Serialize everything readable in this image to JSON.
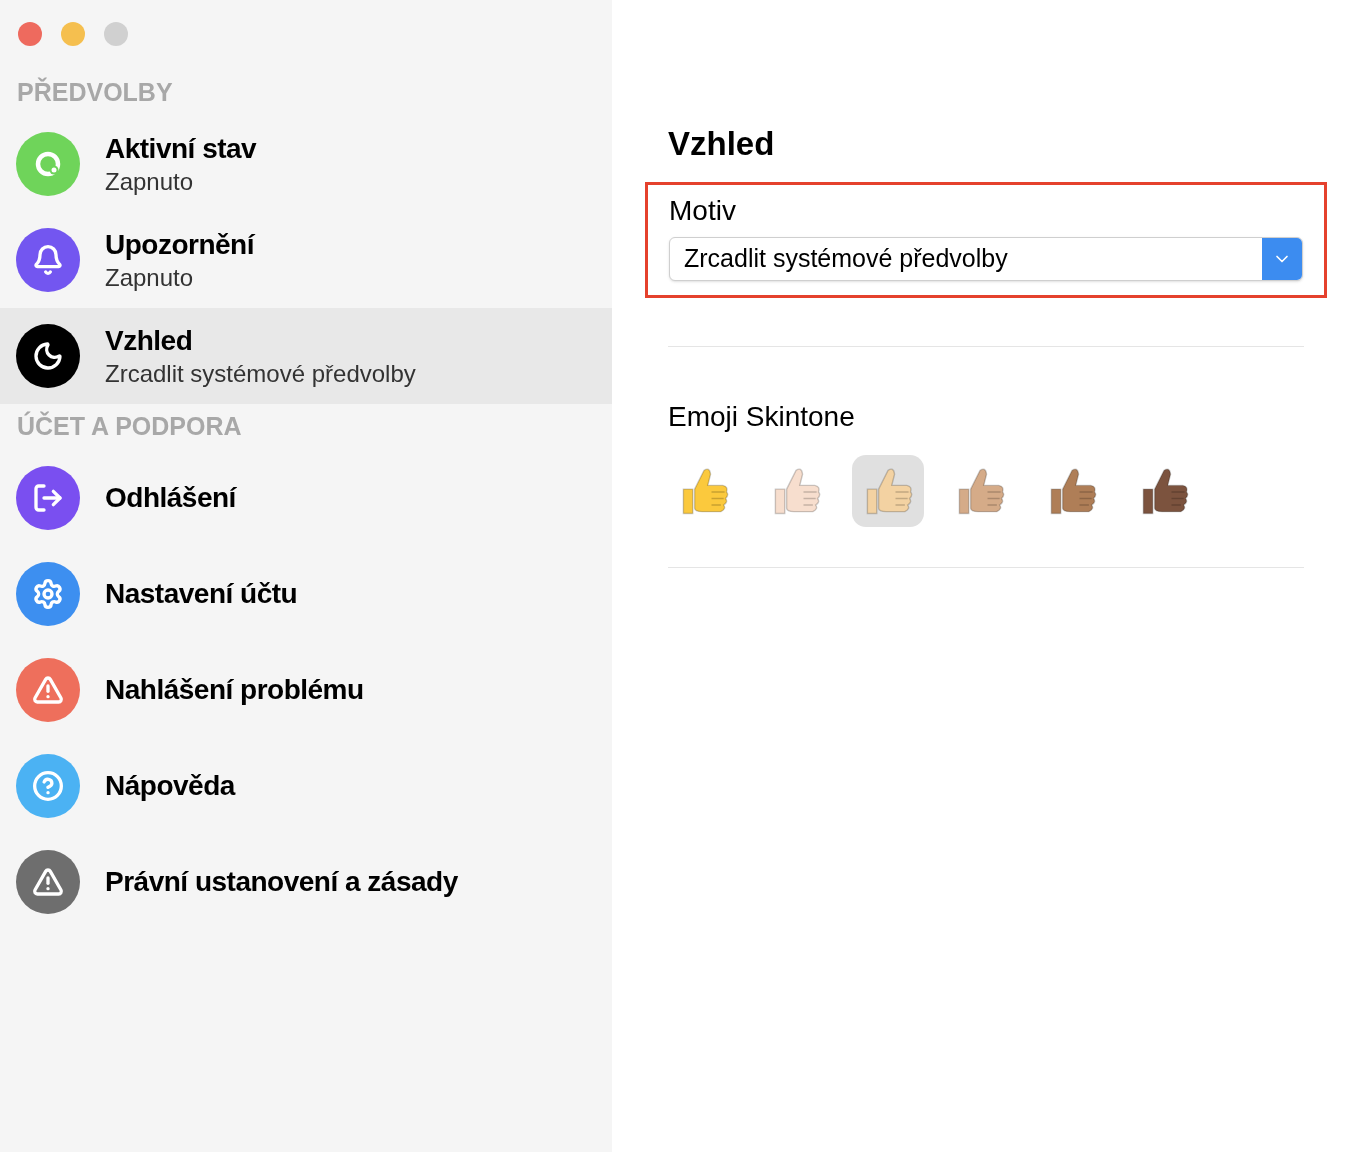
{
  "sidebar": {
    "sections": [
      {
        "title": "PŘEDVOLBY",
        "items": [
          {
            "title": "Aktivní stav",
            "subtitle": "Zapnuto",
            "color": "#6fd45a",
            "selected": false
          },
          {
            "title": "Upozornění",
            "subtitle": "Zapnuto",
            "color": "#7356f0",
            "selected": false
          },
          {
            "title": "Vzhled",
            "subtitle": "Zrcadlit systémové předvolby",
            "color": "#000000",
            "selected": true
          }
        ]
      },
      {
        "title": "ÚČET A PODPORA",
        "items": [
          {
            "title": "Odhlášení",
            "color": "#7a4ff0",
            "selected": false
          },
          {
            "title": "Nastavení účtu",
            "color": "#3d8ff0",
            "selected": false
          },
          {
            "title": "Nahlášení problému",
            "color": "#ee6f5c",
            "selected": false
          },
          {
            "title": "Nápověda",
            "color": "#4bb2f3",
            "selected": false
          },
          {
            "title": "Právní ustanovení a zásady",
            "color": "#6e6e6e",
            "selected": false
          }
        ]
      }
    ]
  },
  "content": {
    "title": "Vzhled",
    "theme": {
      "label": "Motiv",
      "value": "Zrcadlit systémové předvolby",
      "highlighted": true
    },
    "skintone": {
      "label": "Emoji Skintone",
      "options": [
        {
          "color": "#fbc93d",
          "selected": false
        },
        {
          "color": "#f7dece",
          "selected": false
        },
        {
          "color": "#f3d2a2",
          "selected": true
        },
        {
          "color": "#d5ab88",
          "selected": false
        },
        {
          "color": "#af7e57",
          "selected": false
        },
        {
          "color": "#7c533e",
          "selected": false
        }
      ]
    }
  }
}
